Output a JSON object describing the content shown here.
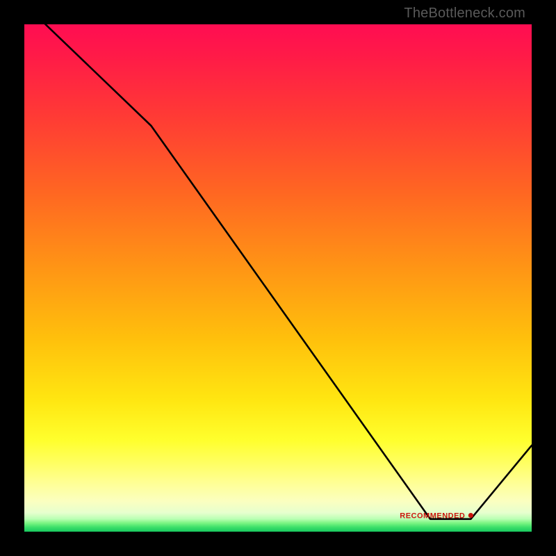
{
  "credit": "TheBottleneck.com",
  "recommended_label": "RECOMMENDED",
  "chart_data": {
    "type": "line",
    "title": "",
    "xlabel": "",
    "ylabel": "",
    "xlim": [
      0,
      100
    ],
    "ylim": [
      0,
      100
    ],
    "series": [
      {
        "name": "bottleneck-curve",
        "x": [
          0,
          25,
          80,
          88,
          100
        ],
        "y": [
          104,
          80,
          2.5,
          2.5,
          17
        ]
      }
    ],
    "markers": [
      {
        "name": "recommended-point",
        "x": 88,
        "y": 3.2,
        "label": "RECOMMENDED"
      }
    ],
    "gradient_stops": [
      {
        "pos": 0.0,
        "color": "#ff0d52"
      },
      {
        "pos": 0.5,
        "color": "#ffb210"
      },
      {
        "pos": 0.82,
        "color": "#ffff2d"
      },
      {
        "pos": 1.0,
        "color": "#18c95f"
      }
    ]
  }
}
